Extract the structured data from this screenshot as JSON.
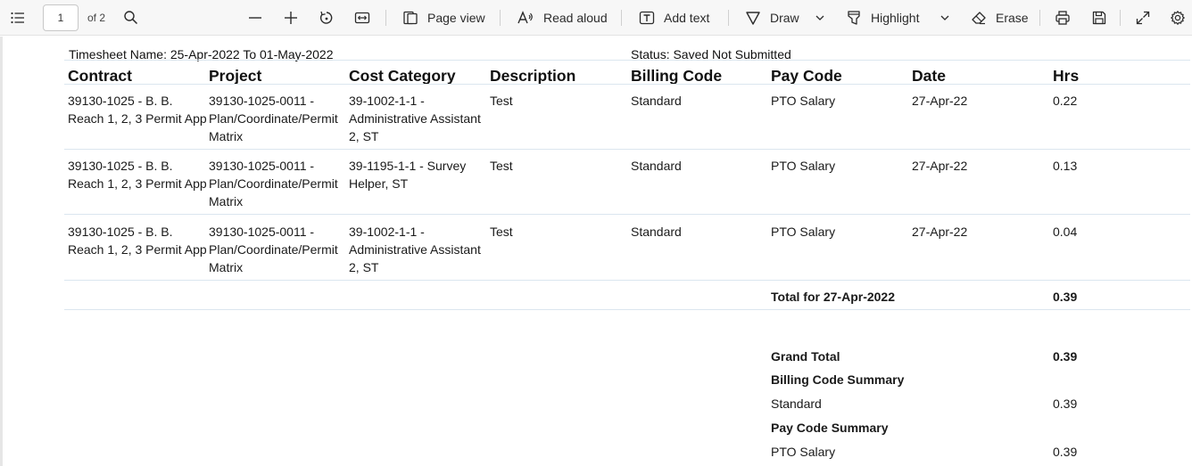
{
  "toolbar": {
    "page_current": "1",
    "page_of": "of 2",
    "page_view": "Page view",
    "read_aloud": "Read aloud",
    "add_text": "Add text",
    "draw": "Draw",
    "highlight": "Highlight",
    "erase": "Erase"
  },
  "doc": {
    "timesheet_name": "Timesheet Name: 25-Apr-2022 To 01-May-2022",
    "status": "Status: Saved Not Submitted",
    "headers": [
      "Contract",
      "Project",
      "Cost Category",
      "Description",
      "Billing Code",
      "Pay Code",
      "Date",
      "Hrs"
    ],
    "rows": [
      {
        "contract": [
          "39130-1025  - B. B.",
          "Reach 1, 2, 3 Permit App"
        ],
        "project": [
          "39130-1025-0011 -",
          "Plan/Coordinate/Permit",
          "Matrix"
        ],
        "cost_category": [
          "39-1002-1-1 -",
          "Administrative Assistant",
          "2, ST"
        ],
        "description": "Test",
        "billing_code": "Standard",
        "pay_code": "PTO Salary",
        "date": "27-Apr-22",
        "hrs": "0.22"
      },
      {
        "contract": [
          "39130-1025  - B. B.",
          "Reach 1, 2, 3 Permit App"
        ],
        "project": [
          "39130-1025-0011 -",
          "Plan/Coordinate/Permit",
          "Matrix"
        ],
        "cost_category": [
          "39-1195-1-1 - Survey",
          "Helper, ST"
        ],
        "description": "Test",
        "billing_code": "Standard",
        "pay_code": "PTO Salary",
        "date": "27-Apr-22",
        "hrs": "0.13"
      },
      {
        "contract": [
          "39130-1025  - B. B.",
          "Reach 1, 2, 3 Permit App"
        ],
        "project": [
          "39130-1025-0011 -",
          "Plan/Coordinate/Permit",
          "Matrix"
        ],
        "cost_category": [
          "39-1002-1-1 -",
          "Administrative Assistant",
          "2, ST"
        ],
        "description": "Test",
        "billing_code": "Standard",
        "pay_code": "PTO Salary",
        "date": "27-Apr-22",
        "hrs": "0.04"
      }
    ],
    "total_label": "Total for 27-Apr-2022",
    "total_value": "0.39",
    "grand_total_label": "Grand Total",
    "grand_total_value": "0.39",
    "billing_summary_label": "Billing Code Summary",
    "billing_summary_item": "Standard",
    "billing_summary_value": "0.39",
    "pay_summary_label": "Pay Code Summary",
    "pay_summary_item": "PTO Salary",
    "pay_summary_value": "0.39"
  }
}
